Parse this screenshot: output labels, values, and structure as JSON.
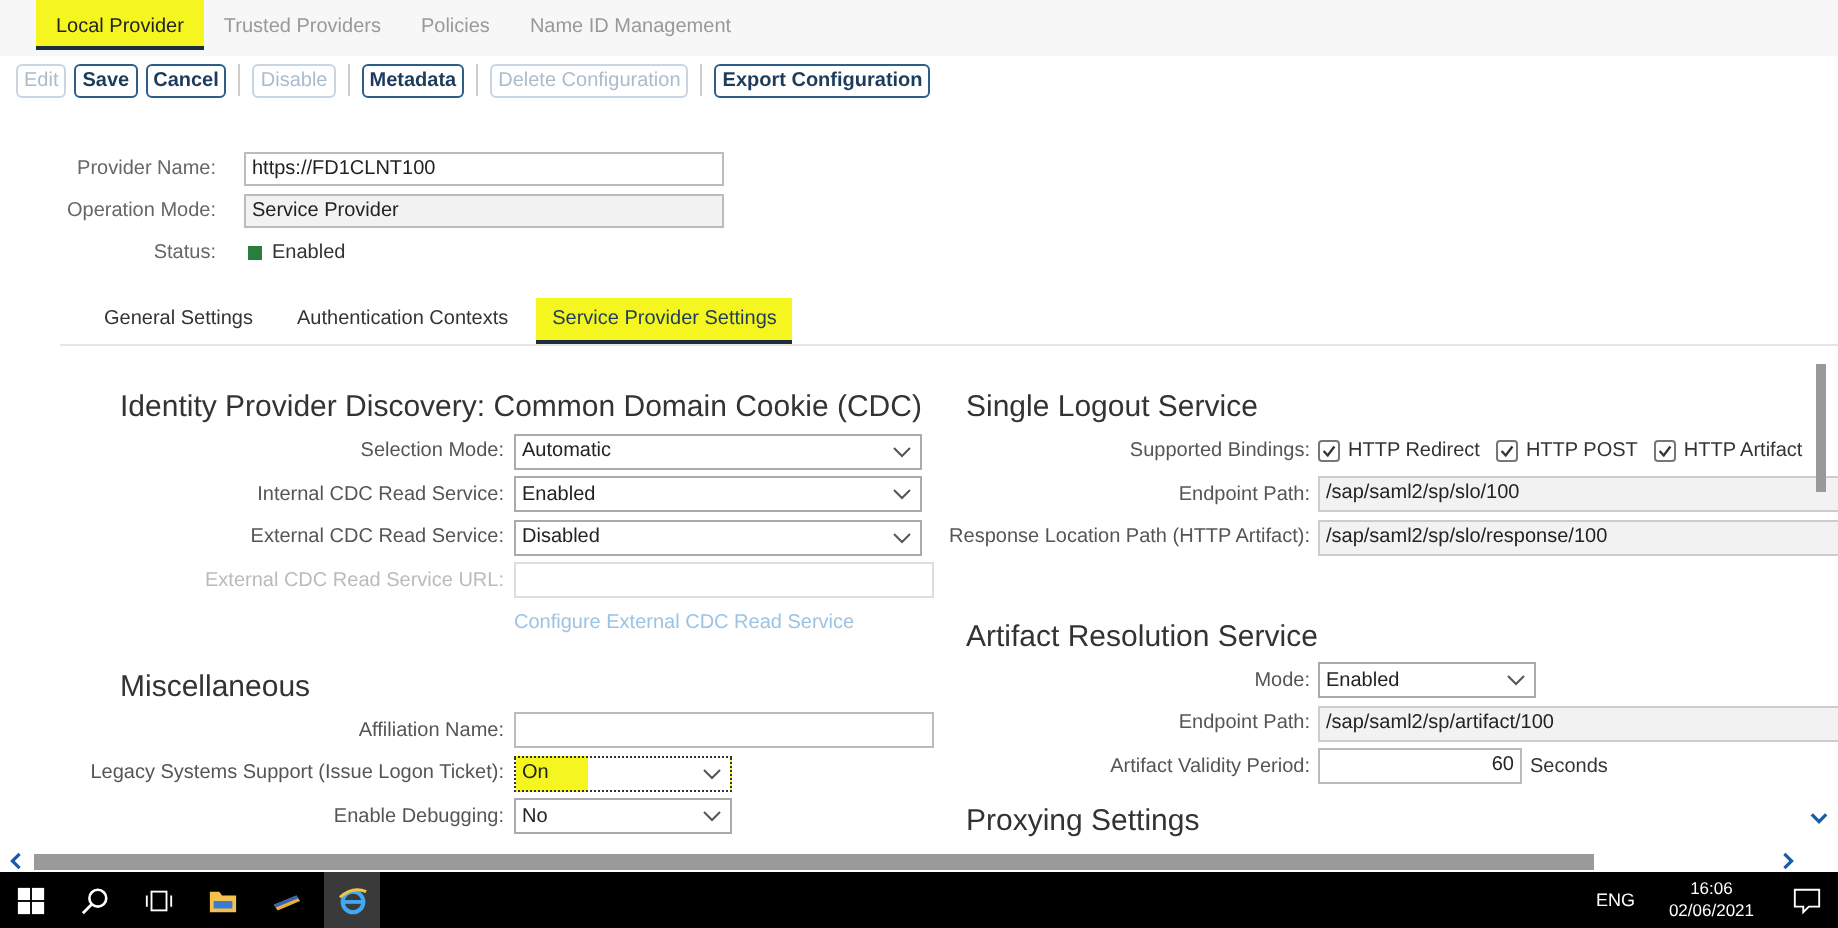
{
  "tabs": [
    {
      "label": "Local Provider",
      "selected": true,
      "highlighted": true
    },
    {
      "label": "Trusted Providers",
      "selected": false,
      "highlighted": false
    },
    {
      "label": "Policies",
      "selected": false,
      "highlighted": false
    },
    {
      "label": "Name ID Management",
      "selected": false,
      "highlighted": false
    }
  ],
  "toolbar": [
    [
      {
        "label": "Edit",
        "disabled": true
      },
      {
        "label": "Save",
        "disabled": false
      },
      {
        "label": "Cancel",
        "disabled": false
      }
    ],
    [
      {
        "label": "Disable",
        "disabled": true
      }
    ],
    [
      {
        "label": "Metadata",
        "disabled": false
      }
    ],
    [
      {
        "label": "Delete Configuration",
        "disabled": true
      }
    ],
    [
      {
        "label": "Export Configuration",
        "disabled": false
      }
    ]
  ],
  "provider": [
    {
      "label": "Provider Name:",
      "kind": "input",
      "value": "https://FD1CLNT100",
      "disabled": false
    },
    {
      "label": "Operation Mode:",
      "kind": "input",
      "value": "Service Provider",
      "disabled": true
    },
    {
      "label": "Status:",
      "kind": "status",
      "value": "Enabled"
    }
  ],
  "subtabs": [
    {
      "label": "General Settings",
      "selected": false,
      "highlighted": false
    },
    {
      "label": "Authentication Contexts",
      "selected": false,
      "highlighted": false
    },
    {
      "label": "Service Provider Settings",
      "selected": true,
      "highlighted": true
    }
  ],
  "left_sections": [
    {
      "title": "Identity Provider Discovery: Common Domain Cookie (CDC)",
      "rows": [
        {
          "label": "Selection Mode:",
          "kind": "select",
          "value": "Automatic",
          "disabled": false,
          "highlighted": false
        },
        {
          "label": "Internal CDC Read Service:",
          "kind": "select",
          "value": "Enabled",
          "disabled": false,
          "highlighted": false
        },
        {
          "label": "External CDC Read Service:",
          "kind": "select",
          "value": "Disabled",
          "disabled": false,
          "highlighted": false
        },
        {
          "label": "External CDC Read Service URL:",
          "kind": "input",
          "disabled": true
        },
        {
          "kind": "link",
          "value": "Configure External CDC Read Service",
          "disabled": true
        }
      ]
    },
    {
      "title": "Miscellaneous",
      "rows": [
        {
          "label": "Affiliation Name:",
          "kind": "input",
          "disabled": false
        },
        {
          "label": "Legacy Systems Support (Issue Logon Ticket):",
          "kind": "select",
          "value": "On",
          "disabled": false,
          "highlighted": true,
          "focused": true
        },
        {
          "label": "Enable Debugging:",
          "kind": "select",
          "value": "No",
          "disabled": false,
          "highlighted": false
        }
      ]
    }
  ],
  "right_sections": [
    {
      "title": "Single Logout Service",
      "rows": [
        {
          "label": "Supported Bindings:",
          "kind": "checks",
          "options": [
            {
              "label": "HTTP Redirect",
              "checked": true
            },
            {
              "label": "HTTP POST",
              "checked": true
            },
            {
              "label": "HTTP Artifact",
              "checked": true
            }
          ]
        },
        {
          "label": "Endpoint Path:",
          "kind": "input",
          "value": "/sap/saml2/sp/slo/100",
          "readonly": true
        },
        {
          "label": "Response Location Path (HTTP Artifact):",
          "kind": "input",
          "value": "/sap/saml2/sp/slo/response/100",
          "readonly": true
        }
      ]
    },
    {
      "title": "Artifact Resolution Service",
      "rows": [
        {
          "label": "Mode:",
          "kind": "select",
          "value": "Enabled",
          "disabled": false,
          "highlighted": false
        },
        {
          "label": "Endpoint Path:",
          "kind": "input",
          "value": "/sap/saml2/sp/artifact/100",
          "readonly": true
        },
        {
          "label": "Artifact Validity Period:",
          "kind": "number",
          "value": "60",
          "unit": "Seconds"
        }
      ]
    },
    {
      "title": "Proxying Settings"
    }
  ],
  "taskbar": {
    "language": "ENG",
    "time": "16:06",
    "date": "02/06/2021"
  }
}
